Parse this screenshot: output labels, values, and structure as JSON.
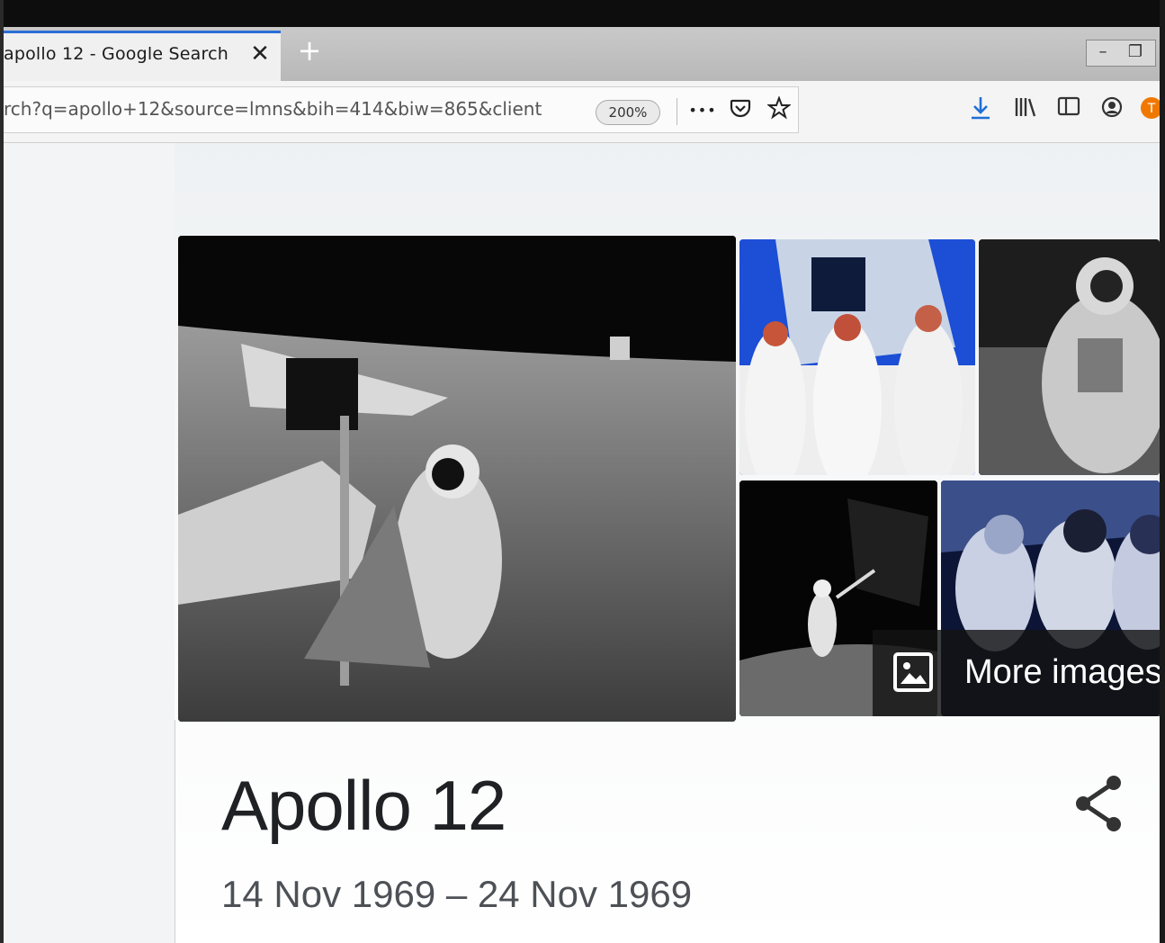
{
  "browser": {
    "tab": {
      "title": "apollo 12 - Google Search",
      "close_glyph": "✕"
    },
    "new_tab_glyph": "+",
    "url": "rch?q=apollo+12&source=lmns&bih=414&biw=865&client",
    "zoom": "200%",
    "more_glyph": "•••",
    "icons": [
      "pocket-icon",
      "bookmark-star-icon",
      "download-icon",
      "library-icon",
      "sidebar-icon",
      "account-icon",
      "extension-icon"
    ]
  },
  "knowledge_panel": {
    "more_images_label": "More images",
    "title": "Apollo 12",
    "dates": "14 Nov 1969 – 24 Nov 1969"
  },
  "colors": {
    "accent_blue": "#2a6fd6",
    "title_text": "#202124",
    "date_text": "#4d5156",
    "extension_orange": "#f07800"
  }
}
